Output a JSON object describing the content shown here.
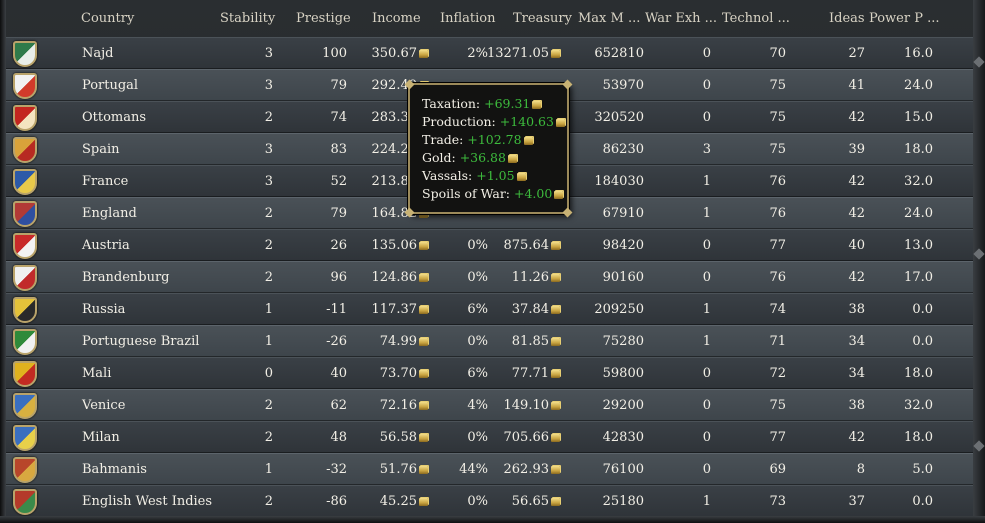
{
  "columns": {
    "country": "Country",
    "stability": "Stability",
    "prestige": "Prestige",
    "income": "Income",
    "inflation": "Inflation",
    "treasury": "Treasury",
    "max_manpower": "Max M ...",
    "war_exhaustion": "War Exh ...",
    "technology": "Technol ...",
    "ideas": "Ideas",
    "power_projection": "Power P ..."
  },
  "rows": [
    {
      "flag_colors": [
        "#2f7a4a",
        "#e9eee9"
      ],
      "country": "Najd",
      "stability": "3",
      "prestige": "100",
      "income": "350.67",
      "inflation": "2%",
      "treasury": "13271.05",
      "max_manpower": "652810",
      "war_exhaustion": "0",
      "technology": "70",
      "ideas": "27",
      "power_projection": "16.0"
    },
    {
      "flag_colors": [
        "#f1f1f1",
        "#d13a2a"
      ],
      "country": "Portugal",
      "stability": "3",
      "prestige": "79",
      "income": "292.49",
      "inflation": "",
      "treasury": "",
      "max_manpower": "53970",
      "war_exhaustion": "0",
      "technology": "75",
      "ideas": "41",
      "power_projection": "24.0"
    },
    {
      "flag_colors": [
        "#c3261f",
        "#f4e4c0"
      ],
      "country": "Ottomans",
      "stability": "2",
      "prestige": "74",
      "income": "283.39",
      "inflation": "",
      "treasury": "",
      "max_manpower": "320520",
      "war_exhaustion": "0",
      "technology": "75",
      "ideas": "42",
      "power_projection": "15.0"
    },
    {
      "flag_colors": [
        "#d9a23a",
        "#b72a22"
      ],
      "country": "Spain",
      "stability": "3",
      "prestige": "83",
      "income": "224.28",
      "inflation": "",
      "treasury": "",
      "max_manpower": "86230",
      "war_exhaustion": "3",
      "technology": "75",
      "ideas": "39",
      "power_projection": "18.0"
    },
    {
      "flag_colors": [
        "#2d5aa8",
        "#e8c94a"
      ],
      "country": "France",
      "stability": "3",
      "prestige": "52",
      "income": "213.86",
      "inflation": "",
      "treasury": "",
      "max_manpower": "184030",
      "war_exhaustion": "1",
      "technology": "76",
      "ideas": "42",
      "power_projection": "32.0"
    },
    {
      "flag_colors": [
        "#b23a36",
        "#2f4fa0"
      ],
      "country": "England",
      "stability": "2",
      "prestige": "79",
      "income": "164.82",
      "inflation": "",
      "treasury": "",
      "max_manpower": "67910",
      "war_exhaustion": "1",
      "technology": "76",
      "ideas": "42",
      "power_projection": "24.0"
    },
    {
      "flag_colors": [
        "#c82a2a",
        "#f3f3f3"
      ],
      "country": "Austria",
      "stability": "2",
      "prestige": "26",
      "income": "135.06",
      "inflation": "0%",
      "treasury": "875.64",
      "max_manpower": "98420",
      "war_exhaustion": "0",
      "technology": "77",
      "ideas": "40",
      "power_projection": "13.0"
    },
    {
      "flag_colors": [
        "#f0f0f0",
        "#c12a2a"
      ],
      "country": "Brandenburg",
      "stability": "2",
      "prestige": "96",
      "income": "124.86",
      "inflation": "0%",
      "treasury": "11.26",
      "max_manpower": "90160",
      "war_exhaustion": "0",
      "technology": "76",
      "ideas": "42",
      "power_projection": "17.0"
    },
    {
      "flag_colors": [
        "#e4c23a",
        "#2a2a2a"
      ],
      "country": "Russia",
      "stability": "1",
      "prestige": "-11",
      "income": "117.37",
      "inflation": "6%",
      "treasury": "37.84",
      "max_manpower": "209250",
      "war_exhaustion": "1",
      "technology": "74",
      "ideas": "38",
      "power_projection": "0.0"
    },
    {
      "flag_colors": [
        "#2f8a3a",
        "#f1f1f1"
      ],
      "country": "Portuguese Brazil",
      "stability": "1",
      "prestige": "-26",
      "income": "74.99",
      "inflation": "0%",
      "treasury": "81.85",
      "max_manpower": "75280",
      "war_exhaustion": "1",
      "technology": "71",
      "ideas": "34",
      "power_projection": "0.0"
    },
    {
      "flag_colors": [
        "#e0b21e",
        "#c22a22"
      ],
      "country": "Mali",
      "stability": "0",
      "prestige": "40",
      "income": "73.70",
      "inflation": "6%",
      "treasury": "77.71",
      "max_manpower": "59800",
      "war_exhaustion": "0",
      "technology": "72",
      "ideas": "34",
      "power_projection": "18.0"
    },
    {
      "flag_colors": [
        "#3a6fc0",
        "#d8b040"
      ],
      "country": "Venice",
      "stability": "2",
      "prestige": "62",
      "income": "72.16",
      "inflation": "4%",
      "treasury": "149.10",
      "max_manpower": "29200",
      "war_exhaustion": "0",
      "technology": "75",
      "ideas": "38",
      "power_projection": "32.0"
    },
    {
      "flag_colors": [
        "#3a6fc0",
        "#e8d04a"
      ],
      "country": "Milan",
      "stability": "2",
      "prestige": "48",
      "income": "56.58",
      "inflation": "0%",
      "treasury": "705.66",
      "max_manpower": "42830",
      "war_exhaustion": "0",
      "technology": "77",
      "ideas": "42",
      "power_projection": "18.0"
    },
    {
      "flag_colors": [
        "#b8462a",
        "#d8a840"
      ],
      "country": "Bahmanis",
      "stability": "1",
      "prestige": "-32",
      "income": "51.76",
      "inflation": "44%",
      "treasury": "262.93",
      "max_manpower": "76100",
      "war_exhaustion": "0",
      "technology": "69",
      "ideas": "8",
      "power_projection": "5.0"
    },
    {
      "flag_colors": [
        "#b43a2a",
        "#3a8a4a"
      ],
      "country": "English West Indies",
      "stability": "2",
      "prestige": "-86",
      "income": "45.25",
      "inflation": "0%",
      "treasury": "56.65",
      "max_manpower": "25180",
      "war_exhaustion": "1",
      "technology": "73",
      "ideas": "37",
      "power_projection": "0.0"
    }
  ],
  "tooltip": {
    "lines": [
      {
        "label": "Taxation:",
        "value": "+69.31"
      },
      {
        "label": "Production:",
        "value": "+140.63"
      },
      {
        "label": "Trade:",
        "value": "+102.78"
      },
      {
        "label": "Gold:",
        "value": "+36.88"
      },
      {
        "label": "Vassals:",
        "value": "+1.05"
      },
      {
        "label": "Spoils of War:",
        "value": "+4.00"
      }
    ]
  },
  "colors": {
    "positive_value": "#3dbb3d",
    "gold_coin": "#d8b44a",
    "row_text": "#f2efe6"
  }
}
